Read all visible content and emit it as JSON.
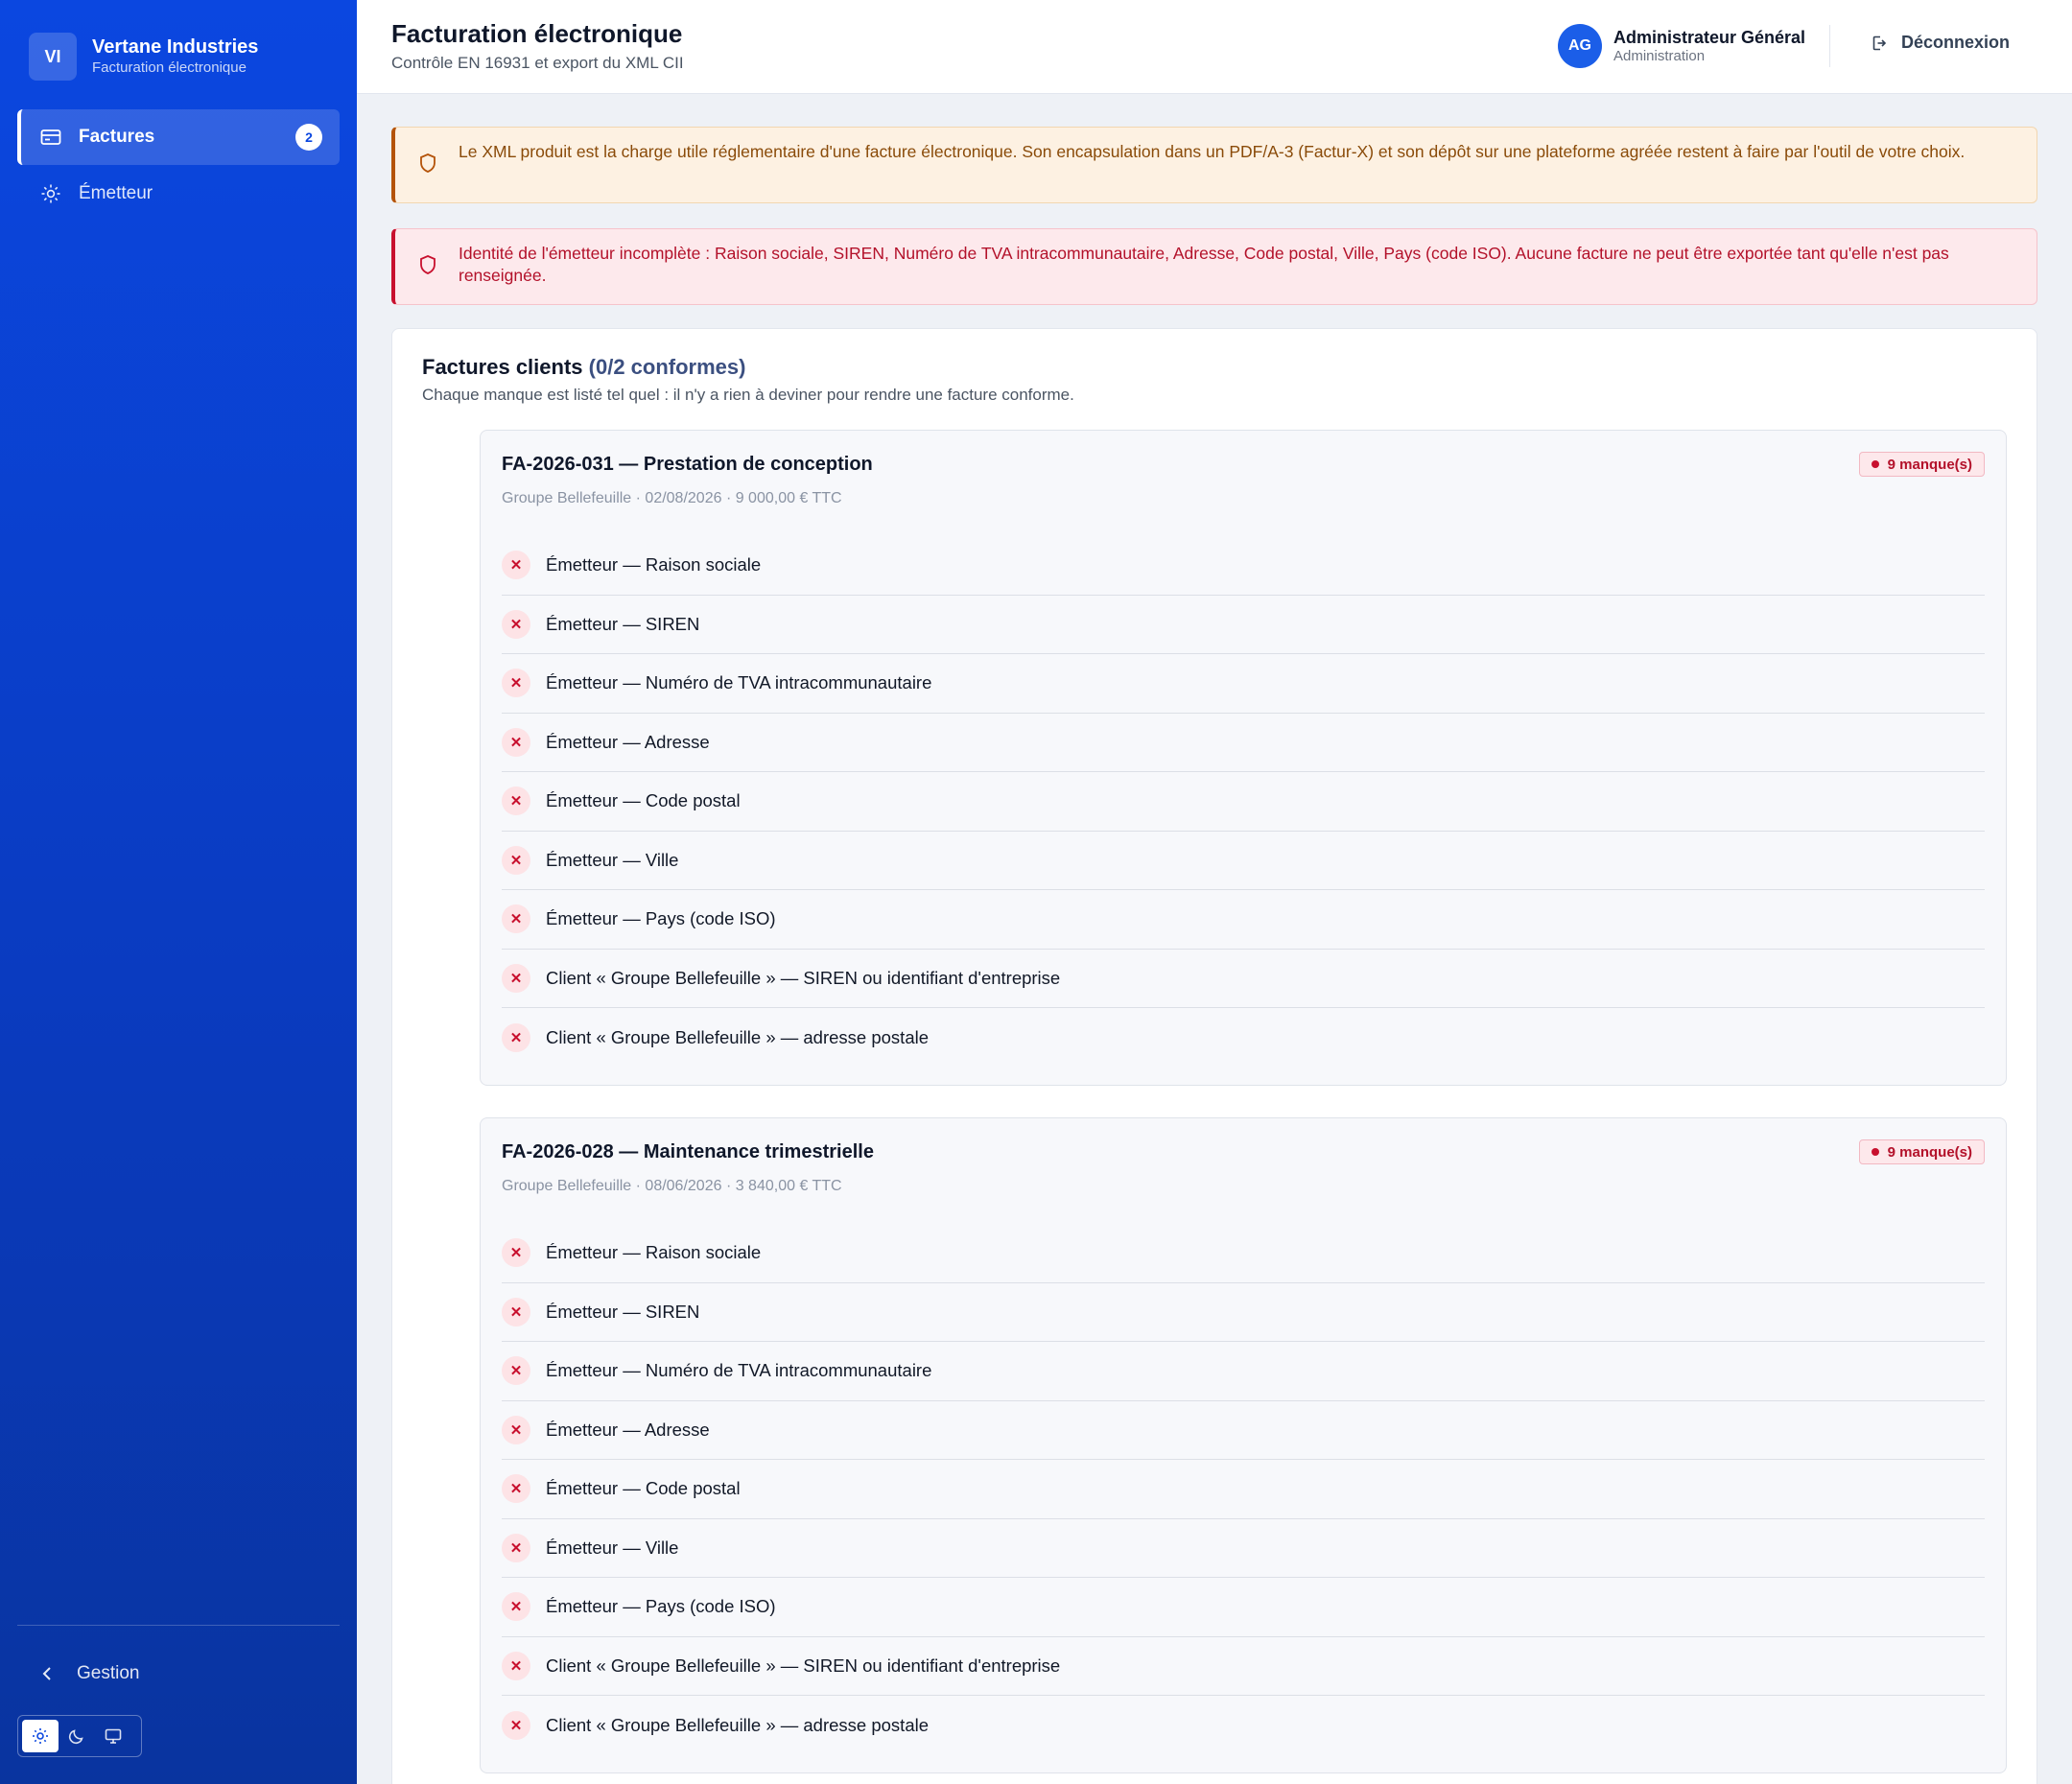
{
  "brand": {
    "initials": "VI",
    "name": "Vertane Industries",
    "subtitle": "Facturation électronique"
  },
  "sidebar": {
    "items": [
      {
        "label": "Factures",
        "icon": "invoice-card-icon",
        "badge": "2",
        "active": true
      },
      {
        "label": "Émetteur",
        "icon": "gear-icon",
        "active": false
      }
    ],
    "footer_link": "Gestion",
    "theme_options": [
      "light",
      "dark",
      "system"
    ],
    "theme_selected": "light"
  },
  "header": {
    "title": "Facturation électronique",
    "subtitle": "Contrôle EN 16931 et export du XML CII",
    "user": {
      "initials": "AG",
      "name": "Administrateur Général",
      "role": "Administration"
    },
    "logout_label": "Déconnexion"
  },
  "alerts": {
    "warning": "Le XML produit est la charge utile réglementaire d'une facture électronique. Son encapsulation dans un PDF/A-3 (Factur-X) et son dépôt sur une plateforme agréée restent à faire par l'outil de votre choix.",
    "error": "Identité de l'émetteur incomplète : Raison sociale, SIREN, Numéro de TVA intracommunautaire, Adresse, Code postal, Ville, Pays (code ISO). Aucune facture ne peut être exportée tant qu'elle n'est pas renseignée."
  },
  "invoices_section": {
    "title": "Factures clients",
    "count": "(0/2 conformes)",
    "subtitle": "Chaque manque est listé tel quel : il n'y a rien à deviner pour rendre une facture conforme."
  },
  "invoices": [
    {
      "title": "FA-2026-031 — Prestation de conception",
      "meta": "Groupe Bellefeuille · 02/08/2026 · 9 000,00 € TTC",
      "badge": "9 manque(s)",
      "issues": [
        "Émetteur — Raison sociale",
        "Émetteur — SIREN",
        "Émetteur — Numéro de TVA intracommunautaire",
        "Émetteur — Adresse",
        "Émetteur — Code postal",
        "Émetteur — Ville",
        "Émetteur — Pays (code ISO)",
        "Client « Groupe Bellefeuille » — SIREN ou identifiant d'entreprise",
        "Client « Groupe Bellefeuille » — adresse postale"
      ]
    },
    {
      "title": "FA-2026-028 — Maintenance trimestrielle",
      "meta": "Groupe Bellefeuille · 08/06/2026 · 3 840,00 € TTC",
      "badge": "9 manque(s)",
      "issues": [
        "Émetteur — Raison sociale",
        "Émetteur — SIREN",
        "Émetteur — Numéro de TVA intracommunautaire",
        "Émetteur — Adresse",
        "Émetteur — Code postal",
        "Émetteur — Ville",
        "Émetteur — Pays (code ISO)",
        "Client « Groupe Bellefeuille » — SIREN ou identifiant d'entreprise",
        "Client « Groupe Bellefeuille » — adresse postale"
      ]
    }
  ],
  "colors": {
    "sidebar": "#0b47e0",
    "accent": "#1b5ee8",
    "error": "#c8102e",
    "warning": "#b45309"
  }
}
